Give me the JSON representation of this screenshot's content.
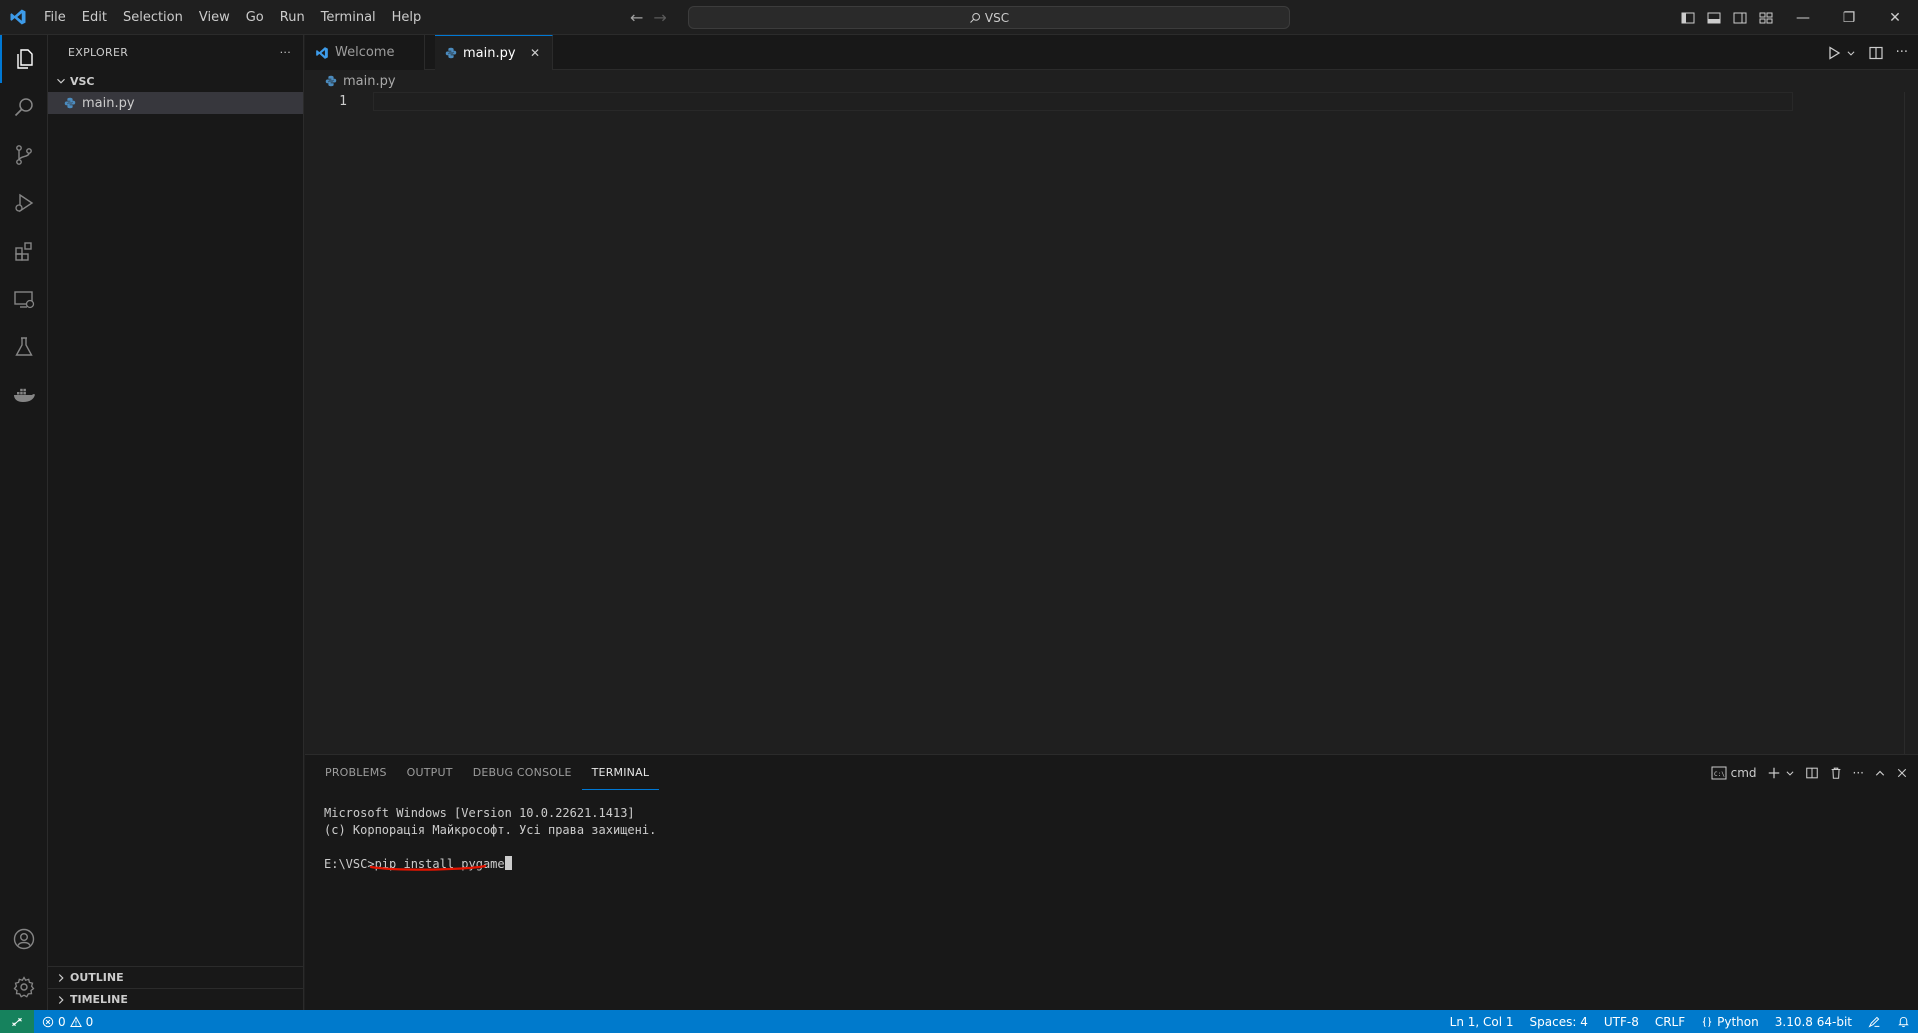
{
  "window": {
    "search_text": "VSC",
    "minimize": "—",
    "restore": "❐",
    "close": "✕"
  },
  "menu": [
    "File",
    "Edit",
    "Selection",
    "View",
    "Go",
    "Run",
    "Terminal",
    "Help"
  ],
  "sidebar": {
    "header": "EXPLORER",
    "more": "···",
    "folder": "VSC",
    "file": "main.py",
    "outline": "OUTLINE",
    "timeline": "TIMELINE"
  },
  "editor": {
    "tabs": [
      {
        "label": "Welcome"
      },
      {
        "label": "main.py"
      }
    ],
    "tab_close": "✕",
    "breadcrumb": "main.py",
    "line_numbers": [
      "1"
    ],
    "more": "···"
  },
  "panel": {
    "tabs": [
      "PROBLEMS",
      "OUTPUT",
      "DEBUG CONSOLE",
      "TERMINAL"
    ],
    "terminal_profile": "cmd",
    "more": "···",
    "terminal_lines": [
      "Microsoft Windows [Version 10.0.22621.1413]",
      "(c) Корпорація Майкрософт. Усі права захищені."
    ],
    "prompt": "E:\\VSC>",
    "command": "pip install pygame"
  },
  "statusbar": {
    "errors": "0",
    "warnings": "0",
    "position": "Ln 1, Col 1",
    "spaces": "Spaces: 4",
    "encoding": "UTF-8",
    "eol": "CRLF",
    "language": "Python",
    "interpreter": "3.10.8 64-bit"
  },
  "colors": {
    "accent": "#0078d4",
    "statusbar": "#007acc",
    "remote": "#16825d",
    "underline": "#e51400",
    "python_icon": "#4b8bbe"
  }
}
